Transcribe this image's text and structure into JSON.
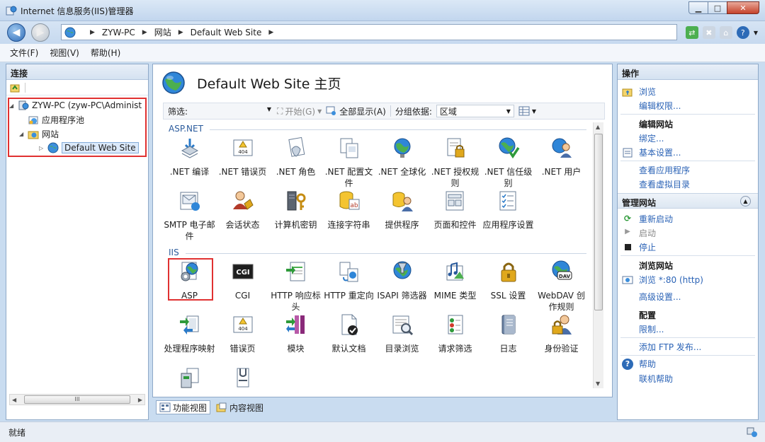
{
  "window": {
    "title": "Internet 信息服务(IIS)管理器"
  },
  "address": {
    "segments": [
      "ZYW-PC",
      "网站",
      "Default Web Site"
    ]
  },
  "menu": {
    "items": [
      "文件(F)",
      "视图(V)",
      "帮助(H)"
    ]
  },
  "connections": {
    "title": "连接",
    "tree": [
      {
        "label": "ZYW-PC (zyw-PC\\Administ"
      },
      {
        "label": "应用程序池"
      },
      {
        "label": "网站"
      },
      {
        "label": "Default Web Site"
      }
    ],
    "scroll_label": "III"
  },
  "center": {
    "title": "Default Web Site 主页",
    "filter": {
      "label": "筛选:",
      "start": "开始(G)",
      "show_all": "全部显示(A)",
      "group_by_label": "分组依据:",
      "group_by_value": "区域"
    },
    "groups": [
      {
        "name": "ASP.NET",
        "items": [
          {
            "label": ".NET 编译",
            "icon": "download-arrow-icon"
          },
          {
            "label": ".NET 错误页",
            "icon": "error-404-icon"
          },
          {
            "label": ".NET 角色",
            "icon": "role-document-icon"
          },
          {
            "label": ".NET 配置文件",
            "icon": "profile-document-icon"
          },
          {
            "label": ".NET 全球化",
            "icon": "globe-icon"
          },
          {
            "label": ".NET 授权规则",
            "icon": "lock-document-icon"
          },
          {
            "label": ".NET 信任级别",
            "icon": "trust-globe-icon"
          },
          {
            "label": ".NET 用户",
            "icon": "user-globe-icon"
          },
          {
            "label": "SMTP 电子邮件",
            "icon": "email-icon"
          },
          {
            "label": "会话状态",
            "icon": "session-user-icon"
          },
          {
            "label": "计算机密钥",
            "icon": "server-key-icon"
          },
          {
            "label": "连接字符串",
            "icon": "database-ab-icon"
          },
          {
            "label": "提供程序",
            "icon": "provider-users-icon"
          },
          {
            "label": "页面和控件",
            "icon": "page-controls-icon"
          },
          {
            "label": "应用程序设置",
            "icon": "settings-list-icon"
          }
        ]
      },
      {
        "name": "IIS",
        "items": [
          {
            "label": "ASP",
            "icon": "asp-globe-gear-icon"
          },
          {
            "label": "CGI",
            "icon": "cgi-icon"
          },
          {
            "label": "HTTP 响应标头",
            "icon": "response-header-icon"
          },
          {
            "label": "HTTP 重定向",
            "icon": "redirect-icon"
          },
          {
            "label": "ISAPI 筛选器",
            "icon": "filter-funnel-icon"
          },
          {
            "label": "MIME 类型",
            "icon": "mime-media-icon"
          },
          {
            "label": "SSL 设置",
            "icon": "padlock-icon"
          },
          {
            "label": "WebDAV 创作规则",
            "icon": "webdav-globe-icon"
          },
          {
            "label": "处理程序映射",
            "icon": "handler-mapping-icon"
          },
          {
            "label": "错误页",
            "icon": "error-404-icon"
          },
          {
            "label": "模块",
            "icon": "modules-icon"
          },
          {
            "label": "默认文档",
            "icon": "default-document-icon"
          },
          {
            "label": "目录浏览",
            "icon": "directory-browse-icon"
          },
          {
            "label": "请求筛选",
            "icon": "request-filter-icon"
          },
          {
            "label": "日志",
            "icon": "log-notebook-icon"
          },
          {
            "label": "身份验证",
            "icon": "authentication-user-icon"
          },
          {
            "label": "",
            "icon": "output-cache-icon"
          },
          {
            "label": "",
            "icon": "compression-icon"
          }
        ]
      }
    ],
    "view_tabs": [
      "功能视图",
      "内容视图"
    ]
  },
  "actions": {
    "title": "操作",
    "browse": "浏览",
    "edit_perms": "编辑权限...",
    "edit_site": "编辑网站",
    "bindings": "绑定...",
    "basic_settings": "基本设置...",
    "view_apps": "查看应用程序",
    "view_vdirs": "查看虚拟目录",
    "manage_site": "管理网站",
    "restart": "重新启动",
    "start": "启动",
    "stop": "停止",
    "browse_site": "浏览网站",
    "browse_http": "浏览 *:80 (http)",
    "advanced": "高级设置...",
    "config": "配置",
    "limits": "限制...",
    "add_ftp": "添加 FTP 发布...",
    "help": "帮助",
    "online_help": "联机帮助"
  },
  "status": {
    "text": "就绪"
  },
  "colors": {
    "link": "#2b63b6",
    "highlight_box": "#e03131",
    "group_heading": "#2b5b9c"
  }
}
